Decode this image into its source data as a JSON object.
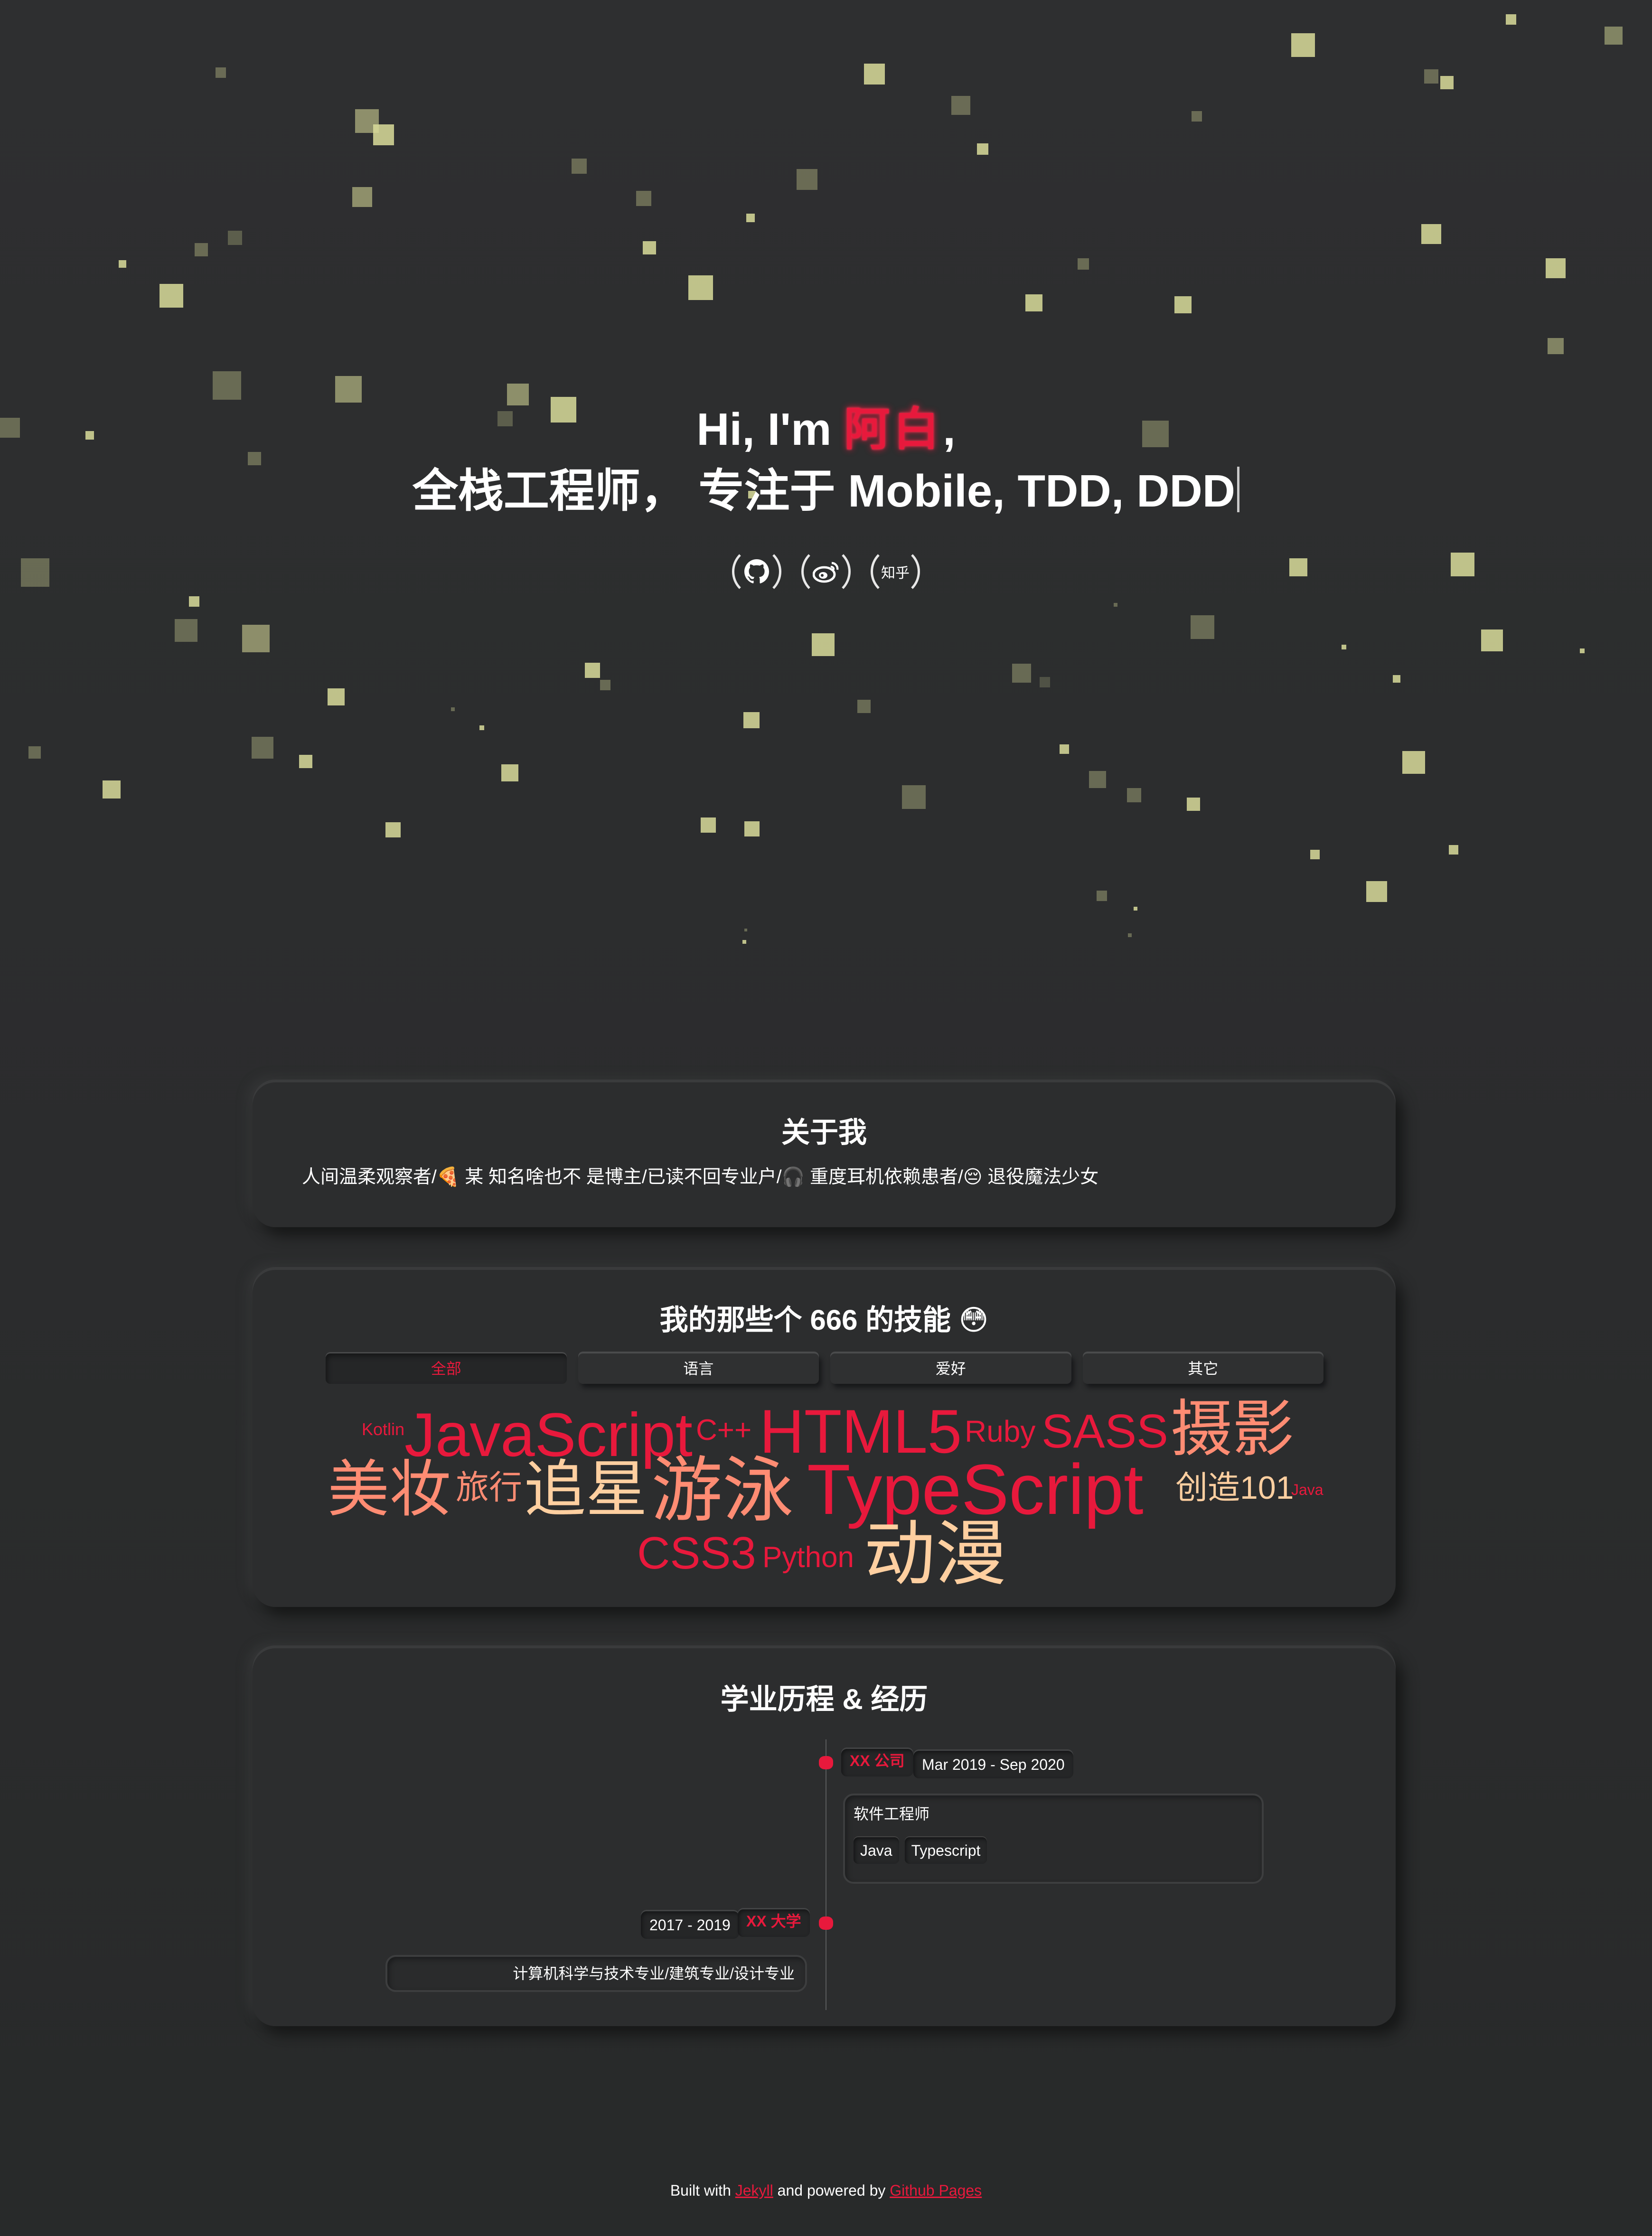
{
  "hero": {
    "greeting": "Hi, I'm ",
    "name": "阿白",
    "comma": ",",
    "intro": "全栈工程师， 专注于 Mobile, TDD, DDD",
    "social": [
      {
        "name": "github-icon",
        "label": ""
      },
      {
        "name": "weibo-icon",
        "label": ""
      },
      {
        "name": "zhihu-icon",
        "label": "知乎"
      }
    ]
  },
  "about": {
    "title": "关于我",
    "text": "人间温柔观察者/🍕 某 知名啥也不 是博主/已读不回专业户/🎧 重度耳机依赖患者/😔 退役魔法少女"
  },
  "skills": {
    "title": "我的那些个 666 的技能 😳",
    "tabs": [
      "全部",
      "语言",
      "爱好",
      "其它"
    ],
    "active_tab": "全部",
    "words": [
      {
        "text": "Kotlin",
        "color": "#e8193c"
      },
      {
        "text": "JavaScript",
        "color": "#e8193c"
      },
      {
        "text": "C++",
        "color": "#e8193c"
      },
      {
        "text": "HTML5",
        "color": "#e8193c"
      },
      {
        "text": "Ruby",
        "color": "#e8193c"
      },
      {
        "text": "SASS",
        "color": "#e8193c"
      },
      {
        "text": "摄影",
        "color": "#ff8c73"
      },
      {
        "text": "美妆",
        "color": "#ff8c73"
      },
      {
        "text": "旅行",
        "color": "#ff8c73"
      },
      {
        "text": "追星",
        "color": "#ffcfa0"
      },
      {
        "text": "游泳",
        "color": "#ff8c73"
      },
      {
        "text": "TypeScript",
        "color": "#e8193c"
      },
      {
        "text": "创造101",
        "color": "#ffcfa0"
      },
      {
        "text": "Java",
        "color": "#e8193c"
      },
      {
        "text": "CSS3",
        "color": "#e8193c"
      },
      {
        "text": "Python",
        "color": "#e8193c"
      },
      {
        "text": "动漫",
        "color": "#ffcfa0"
      }
    ]
  },
  "timeline": {
    "title": "学业历程 & 经历",
    "entries": [
      {
        "org": "XX 公司",
        "date": "Mar 2019 - Sep 2020",
        "desc": "软件工程师",
        "chips": [
          "Java",
          "Typescript"
        ]
      },
      {
        "org": "XX 大学",
        "date": "2017 - 2019",
        "desc": "计算机科学与技术专业/建筑专业/设计专业",
        "chips": []
      }
    ]
  },
  "footer": {
    "built": "Built with",
    "jekyll": "Jekyll",
    "powered": "and powered by",
    "pages": "Github Pages"
  },
  "colors": {
    "accent": "#e8193c",
    "background": "#2c2d2e",
    "square": "#d9dc9a"
  }
}
